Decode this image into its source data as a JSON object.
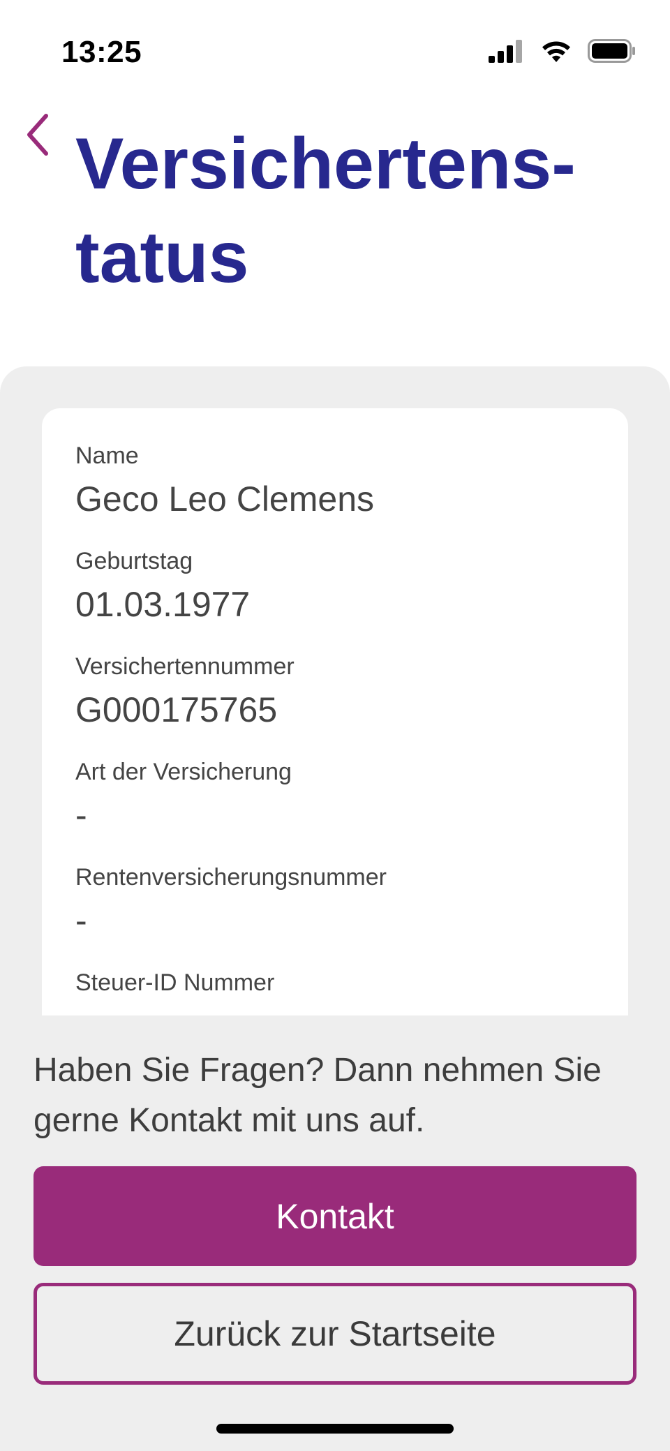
{
  "status_bar": {
    "time": "13:25"
  },
  "header": {
    "title": "Versichertens-tatus"
  },
  "info": {
    "fields": [
      {
        "label": "Name",
        "value": "Geco Leo Clemens"
      },
      {
        "label": "Geburtstag",
        "value": "01.03.1977"
      },
      {
        "label": "Versichertennummer",
        "value": "G000175765"
      },
      {
        "label": "Art der Versicherung",
        "value": "-"
      },
      {
        "label": "Rentenversicherungsnummer",
        "value": "-"
      },
      {
        "label": "Steuer-ID Nummer",
        "value": ""
      }
    ]
  },
  "help": {
    "text": "Haben Sie Fragen? Dann nehmen Sie gerne Kontakt mit uns auf."
  },
  "buttons": {
    "contact_label": "Kontakt",
    "home_label": "Zurück zur Startseite"
  },
  "colors": {
    "title": "#27288e",
    "accent": "#992b7a",
    "sheet_background": "#eeeeee"
  }
}
